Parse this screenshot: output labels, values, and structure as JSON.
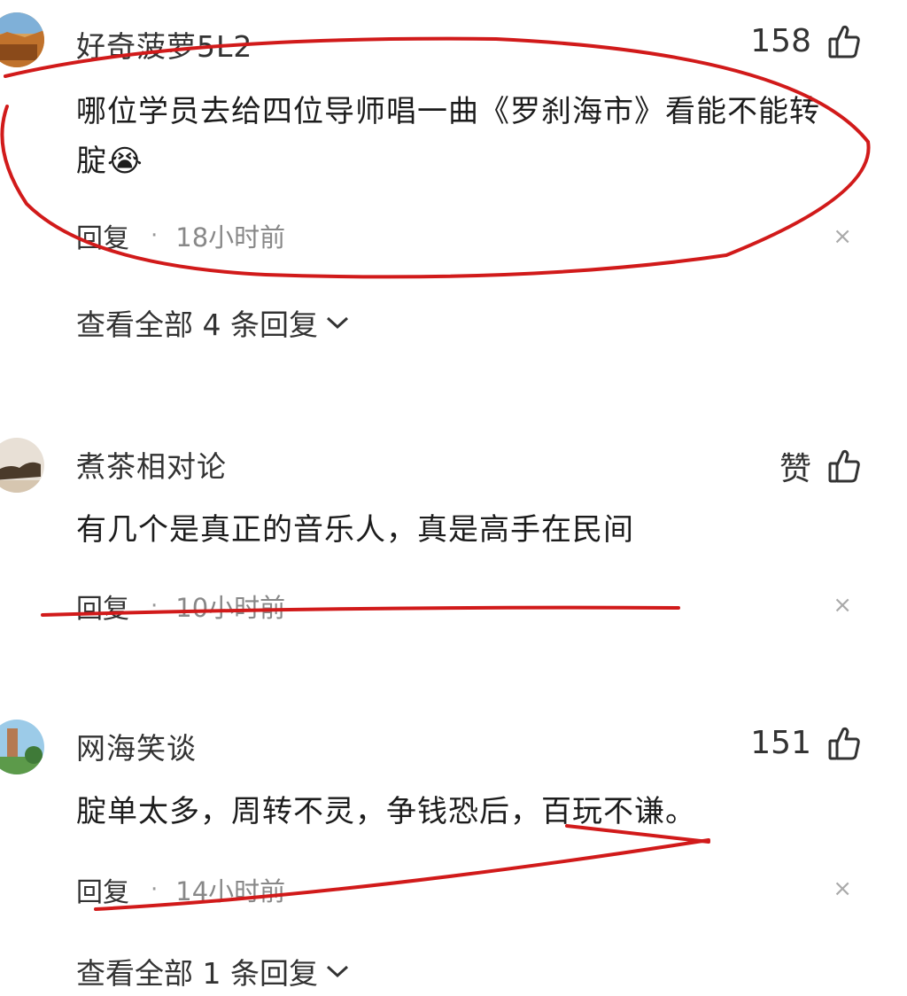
{
  "comments": [
    {
      "username": "好奇菠萝5L2",
      "likes": "158",
      "text": "哪位学员去给四位导师唱一曲《罗刹海市》看能不能转腚😭",
      "reply_label": "回复",
      "separator": "·",
      "time": "18小时前",
      "close": "×",
      "view_all": "查看全部 4 条回复"
    },
    {
      "username": "煮茶相对论",
      "likes": "赞",
      "text": "有几个是真正的音乐人，真是高手在民间",
      "reply_label": "回复",
      "separator": "·",
      "time": "10小时前",
      "close": "×"
    },
    {
      "username": "网海笑谈",
      "likes": "151",
      "text": "腚单太多，周转不灵，争钱恐后，百玩不谦。",
      "reply_label": "回复",
      "separator": "·",
      "time": "14小时前",
      "close": "×",
      "view_all": "查看全部 1 条回复"
    }
  ],
  "icons": {
    "like": "thumbs-up-icon",
    "expand": "chevron-down-icon"
  },
  "colors": {
    "annotation": "#d11a1a",
    "text": "#1c1c1c",
    "muted": "#888888"
  }
}
